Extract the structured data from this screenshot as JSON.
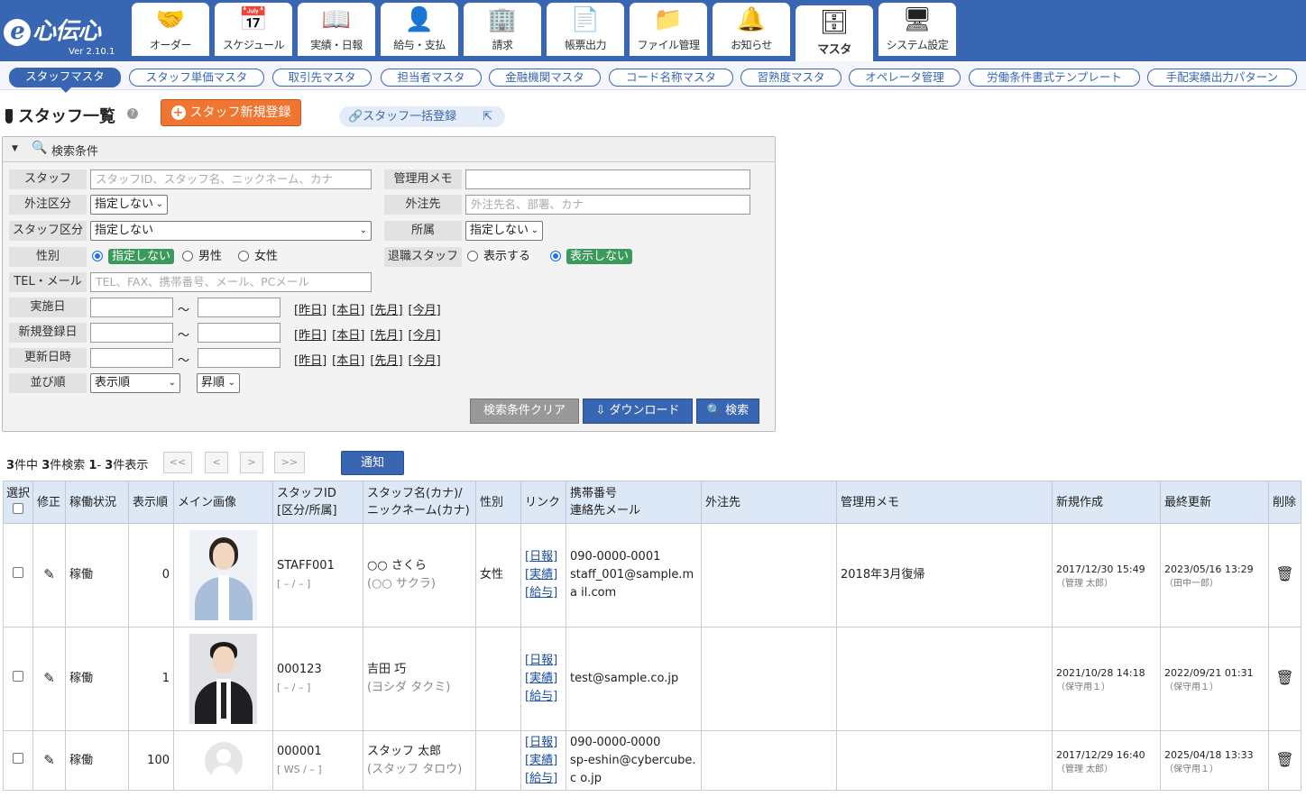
{
  "app": {
    "logo_text": "心伝心",
    "logo_e": "e",
    "version": "Ver 2.10.1"
  },
  "nav": [
    {
      "label": "オーダー",
      "icon": "handshake-icon",
      "glyph": "🤝"
    },
    {
      "label": "スケジュール",
      "icon": "calendar-icon",
      "glyph": "📅"
    },
    {
      "label": "実績・日報",
      "icon": "book-icon",
      "glyph": "📖"
    },
    {
      "label": "給与・支払",
      "icon": "person-money-icon",
      "glyph": "👤"
    },
    {
      "label": "請求",
      "icon": "building-invoice-icon",
      "glyph": "🏢"
    },
    {
      "label": "帳票出力",
      "icon": "documents-icon",
      "glyph": "📄"
    },
    {
      "label": "ファイル管理",
      "icon": "folder-icon",
      "glyph": "📁"
    },
    {
      "label": "お知らせ",
      "icon": "bell-icon",
      "glyph": "🔔"
    },
    {
      "label": "マスタ",
      "icon": "database-gear-icon",
      "glyph": "🗄"
    },
    {
      "label": "システム設定",
      "icon": "monitor-settings-icon",
      "glyph": "🖥"
    }
  ],
  "subnav": [
    "スタッフマスタ",
    "スタッフ単価マスタ",
    "取引先マスタ",
    "担当者マスタ",
    "金融機関マスタ",
    "コード名称マスタ",
    "習熟度マスタ",
    "オペレータ管理",
    "労働条件書式テンプレート",
    "手配実績出力パターン"
  ],
  "page": {
    "title": "スタッフ一覧",
    "help": "?",
    "new_button": "スタッフ新規登録",
    "bulk_button": "🔗スタッフ一括登録"
  },
  "search": {
    "header": "検索条件",
    "staff_label": "スタッフ",
    "staff_placeholder": "スタッフID、スタッフ名、ニックネーム、カナ",
    "memo_label": "管理用メモ",
    "outsource_type_label": "外注区分",
    "outsource_type_value": "指定しない",
    "outsource_label": "外注先",
    "outsource_placeholder": "外注先名、部署、カナ",
    "staff_type_label": "スタッフ区分",
    "staff_type_value": "指定しない",
    "affiliation_label": "所属",
    "affiliation_value": "指定しない",
    "gender_label": "性別",
    "gender_options": [
      "指定しない",
      "男性",
      "女性"
    ],
    "retired_label": "退職スタッフ",
    "retired_options": [
      "表示する",
      "表示しない"
    ],
    "tel_label": "TEL・メール",
    "tel_placeholder": "TEL、FAX、携帯番号、メール、PCメール",
    "date_rows": [
      "実施日",
      "新規登録日",
      "更新日時"
    ],
    "tilde": "～",
    "date_links": [
      "昨日",
      "本日",
      "先月",
      "今月"
    ],
    "sort_label": "並び順",
    "sort_value": "表示順",
    "order_value": "昇順",
    "clear_button": "検索条件クリア",
    "download_button": "ダウンロード",
    "search_button": "検索"
  },
  "pagination": {
    "total": "3",
    "total_suffix": "件中",
    "matched": "3",
    "matched_suffix": "件検索",
    "from": "1",
    "to": "3",
    "shown_suffix": "件表示",
    "first": "<<",
    "prev": "<",
    "next": ">",
    "last": ">>",
    "notify_button": "通知"
  },
  "table": {
    "headers": {
      "select": "選択",
      "edit": "修正",
      "status": "稼働状況",
      "order": "表示順",
      "image": "メイン画像",
      "id": "スタッフID",
      "id_sub": "[区分/所属]",
      "name": "スタッフ名(カナ)/",
      "name_sub": "ニックネーム(カナ)",
      "gender": "性別",
      "link": "リンク",
      "phone": "携帯番号",
      "phone_sub": "連絡先メール",
      "outsource": "外注先",
      "memo": "管理用メモ",
      "created": "新規作成",
      "updated": "最終更新",
      "delete": "削除"
    },
    "rows": [
      {
        "status": "稼働",
        "order": "0",
        "id": "STAFF001",
        "id_sub": "[ – / – ]",
        "name": "○○ さくら",
        "kana": "(○○ サクラ)",
        "gender": "女性",
        "links": [
          "[日報]",
          "[実績]",
          "[給与]"
        ],
        "phone": "090-0000-0001",
        "email": "staff_001@sample.ma il.com",
        "outsource": "",
        "memo": "2018年3月復帰",
        "created": "2017/12/30 15:49",
        "created_by": "（管理 太郎）",
        "updated": "2023/05/16 13:29",
        "updated_by": "（田中一郎）",
        "photo": "woman"
      },
      {
        "status": "稼働",
        "order": "1",
        "id": "000123",
        "id_sub": "[ – / – ]",
        "name": "吉田 巧",
        "kana": "(ヨシダ タクミ)",
        "gender": "",
        "links": [
          "[日報]",
          "[実績]",
          "[給与]"
        ],
        "phone": "",
        "email": "test@sample.co.jp",
        "outsource": "",
        "memo": "",
        "created": "2021/10/28 14:18",
        "created_by": "（保守用１）",
        "updated": "2022/09/21 01:31",
        "updated_by": "（保守用１）",
        "photo": "man"
      },
      {
        "status": "稼働",
        "order": "100",
        "id": "000001",
        "id_sub": "[ WS / – ]",
        "name": "スタッフ 太郎",
        "kana": "(スタッフ タロウ)",
        "gender": "",
        "links": [
          "[日報]",
          "[実績]",
          "[給与]"
        ],
        "phone": "090-0000-0000",
        "email": "sp-eshin@cybercube.c o.jp",
        "outsource": "",
        "memo": "",
        "created": "2017/12/29 16:40",
        "created_by": "（管理 太郎）",
        "updated": "2025/04/18 13:33",
        "updated_by": "（保守用１）",
        "photo": "placeholder"
      }
    ]
  },
  "colors": {
    "brand": "#3866b2",
    "accent": "#f07530",
    "selected_green": "#3a9a5a"
  }
}
